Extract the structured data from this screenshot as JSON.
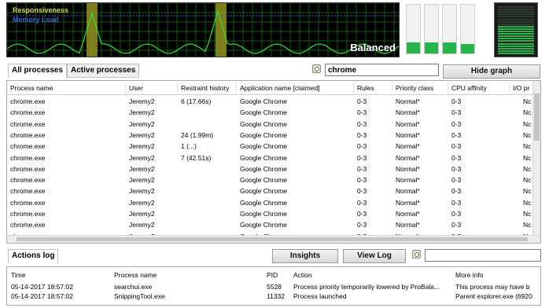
{
  "graph": {
    "legend_responsiveness": "Responsiveness",
    "legend_memory_load": "Memory Load",
    "mode": "Balanced",
    "colors": {
      "background": "#000000",
      "grid": "#0e5d12",
      "line": "#33e033",
      "highlight": "#8c8b1e",
      "memory": "#3f5fd8",
      "legend_resp": "#d8d850"
    }
  },
  "cpu_meter": {
    "levels": [
      0.22,
      0.22,
      0.22,
      0.2
    ],
    "color": "#27b44a"
  },
  "memory_meter": {
    "level": 0.6,
    "color": "#27b44a"
  },
  "process_panel": {
    "tabs": [
      {
        "label": "All processes",
        "active": true
      },
      {
        "label": "Active processes",
        "active": false
      }
    ],
    "search_icon": "magnifier-icon",
    "search_value": "chrome",
    "hide_graph_label": "Hide graph",
    "columns": [
      "Process name",
      "User",
      "Restraint history",
      "Application name [claimed]",
      "Rules",
      "Priority class",
      "CPU affinity",
      "I/O pr"
    ],
    "rows": [
      [
        "chrome.exe",
        "Jeremy2",
        "6 (17.66s)",
        "Google Chrome",
        "0-3",
        "Normal*",
        "0-3",
        "Nc"
      ],
      [
        "chrome.exe",
        "Jeremy2",
        "",
        "Google Chrome",
        "0-3",
        "Normal*",
        "0-3",
        "Nc"
      ],
      [
        "chrome.exe",
        "Jeremy2",
        "",
        "Google Chrome",
        "0-3",
        "Normal*",
        "0-3",
        "Nc"
      ],
      [
        "chrome.exe",
        "Jeremy2",
        "24 (1.99m)",
        "Google Chrome",
        "0-3",
        "Normal*",
        "0-3",
        "Nc"
      ],
      [
        "chrome.exe",
        "Jeremy2",
        "1 (...)",
        "Google Chrome",
        "0-3",
        "Normal*",
        "0-3",
        "Nc"
      ],
      [
        "chrome.exe",
        "Jeremy2",
        "7 (42.51s)",
        "Google Chrome",
        "0-3",
        "Normal*",
        "0-3",
        "Nc"
      ],
      [
        "chrome.exe",
        "Jeremy2",
        "",
        "Google Chrome",
        "0-3",
        "Normal*",
        "0-3",
        "Nc"
      ],
      [
        "chrome.exe",
        "Jeremy2",
        "",
        "Google Chrome",
        "0-3",
        "Normal*",
        "0-3",
        "Nc"
      ],
      [
        "chrome.exe",
        "Jeremy2",
        "",
        "Google Chrome",
        "0-3",
        "Normal*",
        "0-3",
        "Nc"
      ],
      [
        "chrome.exe",
        "Jeremy2",
        "",
        "Google Chrome",
        "0-3",
        "Normal*",
        "0-3",
        "Nc"
      ],
      [
        "chrome.exe",
        "Jeremy2",
        "",
        "Google Chrome",
        "0-3",
        "Normal*",
        "0-3",
        "Nc"
      ],
      [
        "chrome.exe",
        "Jeremy2",
        "",
        "Google Chrome",
        "0-3",
        "Normal*",
        "0-3",
        "Nc"
      ],
      [
        "chrome.exe",
        "Jeremy2",
        "",
        "Google Chrome",
        "0-3",
        "Normal*",
        "0-3",
        "Nc"
      ]
    ]
  },
  "actions_log": {
    "tab_label": "Actions log",
    "insights_label": "Insights",
    "view_log_label": "View Log",
    "search_icon": "magnifier-icon",
    "search_value": "",
    "columns": [
      "Time",
      "Process name",
      "PID",
      "Action",
      "More info"
    ],
    "rows": [
      [
        "05-14-2017 18:57:02",
        "searchui.exe",
        "5528",
        "Process priority temporarily lowered by ProBala...",
        "This process may have b"
      ],
      [
        "05-14-2017 18:57:02",
        "SnippingTool.exe",
        "11332",
        "Process launched",
        "Parent explorer.exe (6920"
      ]
    ]
  }
}
